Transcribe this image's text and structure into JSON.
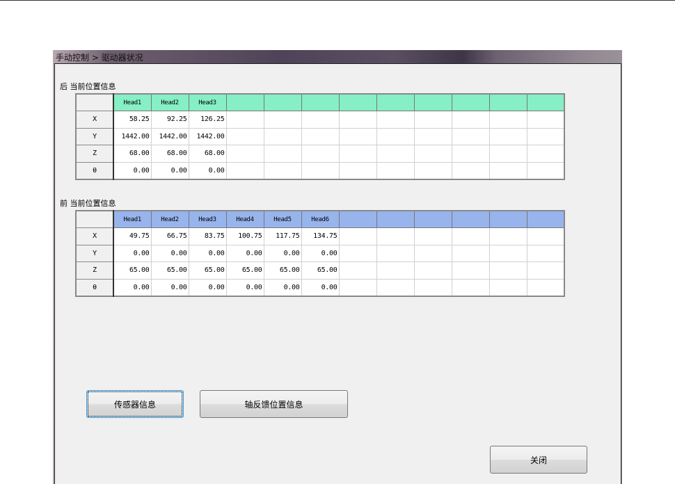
{
  "window": {
    "title": "手动控制 > 驱动器状况"
  },
  "rear": {
    "label": "后 当前位置信息",
    "headers": [
      "Head1",
      "Head2",
      "Head3",
      "",
      "",
      "",
      "",
      "",
      "",
      "",
      "",
      ""
    ],
    "rows": [
      {
        "axis": "X",
        "values": [
          "58.25",
          "92.25",
          "126.25"
        ]
      },
      {
        "axis": "Y",
        "values": [
          "1442.00",
          "1442.00",
          "1442.00"
        ]
      },
      {
        "axis": "Z",
        "values": [
          "68.00",
          "68.00",
          "68.00"
        ]
      },
      {
        "axis": "θ",
        "values": [
          "0.00",
          "0.00",
          "0.00"
        ]
      }
    ]
  },
  "front": {
    "label": "前 当前位置信息",
    "headers": [
      "Head1",
      "Head2",
      "Head3",
      "Head4",
      "Head5",
      "Head6",
      "",
      "",
      "",
      "",
      "",
      ""
    ],
    "rows": [
      {
        "axis": "X",
        "values": [
          "49.75",
          "66.75",
          "83.75",
          "100.75",
          "117.75",
          "134.75"
        ]
      },
      {
        "axis": "Y",
        "values": [
          "0.00",
          "0.00",
          "0.00",
          "0.00",
          "0.00",
          "0.00"
        ]
      },
      {
        "axis": "Z",
        "values": [
          "65.00",
          "65.00",
          "65.00",
          "65.00",
          "65.00",
          "65.00"
        ]
      },
      {
        "axis": "θ",
        "values": [
          "0.00",
          "0.00",
          "0.00",
          "0.00",
          "0.00",
          "0.00"
        ]
      }
    ]
  },
  "buttons": {
    "sensor": "传感器信息",
    "axis_feedback": "轴反馈位置信息",
    "close": "关闭"
  },
  "colors": {
    "rear_header": "#86efc6",
    "front_header": "#98b4ec"
  }
}
